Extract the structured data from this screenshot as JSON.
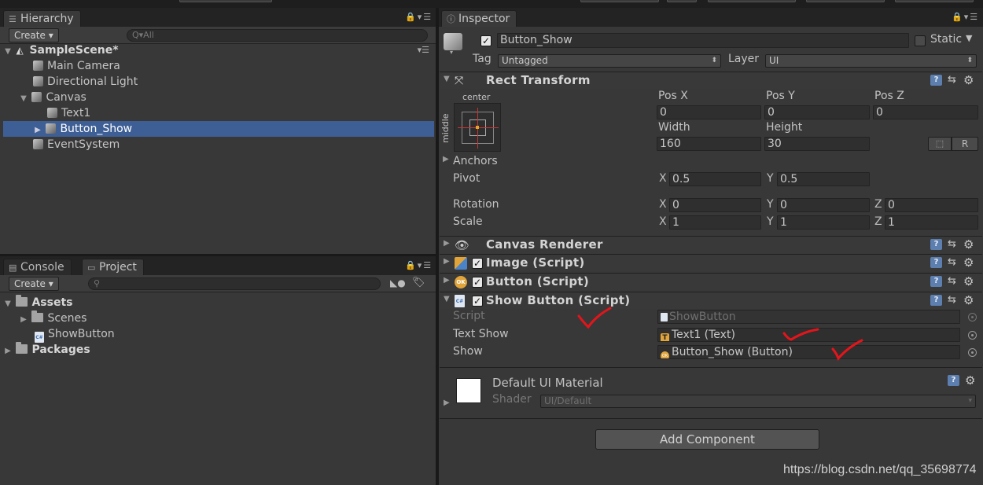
{
  "hierarchy": {
    "tab_label": "Hierarchy",
    "create_label": "Create",
    "search_placeholder": "Q▾All",
    "scene_name": "SampleScene*",
    "items": [
      {
        "label": "Main Camera"
      },
      {
        "label": "Directional Light"
      },
      {
        "label": "Canvas"
      },
      {
        "label": "Text1"
      },
      {
        "label": "Button_Show"
      },
      {
        "label": "EventSystem"
      }
    ]
  },
  "bottom_panel": {
    "console_tab": "Console",
    "project_tab": "Project",
    "create_label": "Create",
    "tree": [
      {
        "label": "Assets"
      },
      {
        "label": "Scenes"
      },
      {
        "label": "ShowButton"
      },
      {
        "label": "Packages"
      }
    ]
  },
  "inspector": {
    "tab_label": "Inspector",
    "object_name": "Button_Show",
    "active": true,
    "static_label": "Static",
    "tag_label": "Tag",
    "tag_value": "Untagged",
    "layer_label": "Layer",
    "layer_value": "UI",
    "rect_transform": {
      "title": "Rect Transform",
      "anchor_h": "center",
      "anchor_v": "middle",
      "pos_x_label": "Pos X",
      "pos_y_label": "Pos Y",
      "pos_z_label": "Pos Z",
      "pos_x": "0",
      "pos_y": "0",
      "pos_z": "0",
      "width_label": "Width",
      "height_label": "Height",
      "width": "160",
      "height": "30",
      "r_button": "R",
      "anchors_label": "Anchors",
      "pivot_label": "Pivot",
      "pivot_x": "0.5",
      "pivot_y": "0.5",
      "rotation_label": "Rotation",
      "rot_x": "0",
      "rot_y": "0",
      "rot_z": "0",
      "scale_label": "Scale",
      "scale_x": "1",
      "scale_y": "1",
      "scale_z": "1",
      "x_axis": "X",
      "y_axis": "Y",
      "z_axis": "Z"
    },
    "components": [
      {
        "title": "Canvas Renderer"
      },
      {
        "title": "Image (Script)"
      },
      {
        "title": "Button (Script)"
      },
      {
        "title": "Show Button (Script)"
      }
    ],
    "show_button": {
      "script_label": "Script",
      "script_value": "ShowButton",
      "text_show_label": "Text Show",
      "text_show_value": "Text1 (Text)",
      "show_label": "Show",
      "show_value": "Button_Show (Button)"
    },
    "material": {
      "name": "Default UI Material",
      "shader_label": "Shader",
      "shader_value": "UI/Default"
    },
    "add_component": "Add Component"
  },
  "watermark": "https://blog.csdn.net/qq_35698774",
  "colors": {
    "selection": "#3e5f96",
    "panel_bg": "#383838",
    "annotation_red": "#e5141b"
  }
}
